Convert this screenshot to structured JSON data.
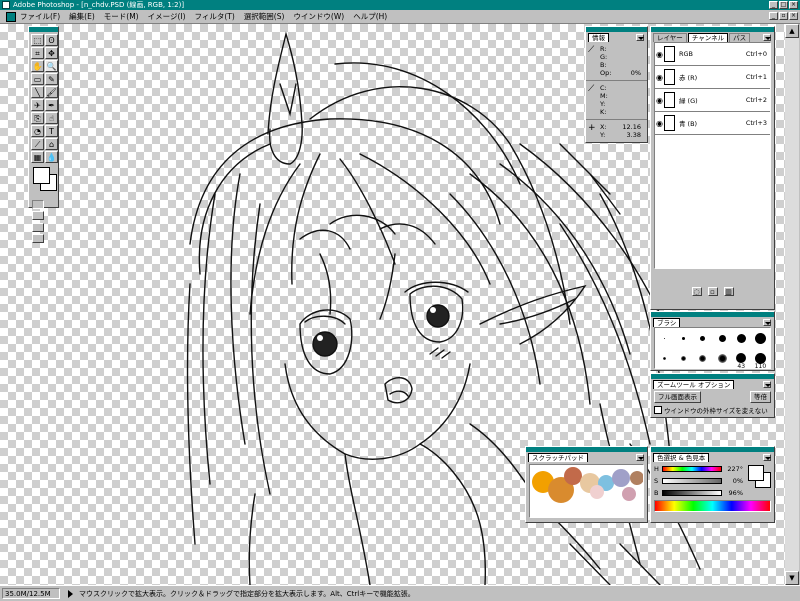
{
  "window": {
    "title": "Adobe Photoshop - [n_chdv.PSD (線画, RGB, 1:2)]"
  },
  "menu": {
    "items": [
      "ファイル(F)",
      "編集(E)",
      "モード(M)",
      "イメージ(I)",
      "フィルタ(T)",
      "選択範囲(S)",
      "ウインドウ(W)",
      "ヘルプ(H)"
    ]
  },
  "toolbox": {
    "tools": [
      "marquee-tool",
      "lasso-tool",
      "crop-tool",
      "move-tool",
      "hand-tool",
      "zoom-tool",
      "eraser-tool",
      "pencil-tool",
      "line-tool",
      "brush-tool",
      "airbrush-tool",
      "pen-tool",
      "rubber-stamp-tool",
      "smudge-tool",
      "dodge-tool",
      "type-tool",
      "eyedropper-tool",
      "bucket-tool",
      "gradient-tool",
      "blur-tool"
    ],
    "glyphs": [
      "⬚",
      "ʘ",
      "⌗",
      "✥",
      "✋",
      "🔍",
      "▭",
      "✎",
      "╲",
      "🖌",
      "✈",
      "✒",
      "⎘",
      "☝",
      "◔",
      "T",
      "⟋",
      "⌂",
      "▦",
      "💧"
    ]
  },
  "info": {
    "tab": "情報",
    "rgb": {
      "r": "",
      "g": "",
      "b": "",
      "op_label": "Op:",
      "op_value": "0%"
    },
    "cmyk": {
      "c_label": "C:",
      "m_label": "M:",
      "y_label": "Y:",
      "k_label": "K:"
    },
    "pos": {
      "x_label": "X:",
      "x_value": "12.16",
      "y_label": "Y:",
      "y_value": "3.38"
    }
  },
  "layers": {
    "tabs": [
      "レイヤー",
      "チャンネル",
      "パス"
    ],
    "active_tab": 1,
    "channels": [
      {
        "name": "RGB",
        "shortcut": "Ctrl+0"
      },
      {
        "name": "赤 (R)",
        "shortcut": "Ctrl+1"
      },
      {
        "name": "緑 (G)",
        "shortcut": "Ctrl+2"
      },
      {
        "name": "青 (B)",
        "shortcut": "Ctrl+3"
      }
    ]
  },
  "brushes": {
    "tab": "ブラシ",
    "labels": {
      "b43": "43",
      "b110": "110"
    }
  },
  "zoom_options": {
    "tab": "ズームツール オプション",
    "fit_button": "フル画面表示",
    "actual_button": "等倍",
    "resize_checkbox": "ウインドウの外枠サイズを変えない"
  },
  "scratch": {
    "tab": "スクラッチパッド"
  },
  "color_picker": {
    "tab": "色選択 & 色見本",
    "h_label": "H",
    "h_value": "227°",
    "s_label": "S",
    "s_value": "0%",
    "b_label": "B",
    "b_value": "96%"
  },
  "status": {
    "zoom": "35.0M/12.5M",
    "message": "マウスクリックで拡大表示。クリック＆ドラッグで指定部分を拡大表示します。Alt、Ctrlキーで機能拡張。"
  },
  "colors": {
    "title_bar": "#008080",
    "chrome": "#c0c0c0",
    "scratch_blobs": [
      "#f2a000",
      "#d98b2e",
      "#c26a4a",
      "#e8c8a0",
      "#7ec0e0",
      "#a0a0c8",
      "#f0d0d0",
      "#d0a0b0",
      "#b08060"
    ]
  }
}
